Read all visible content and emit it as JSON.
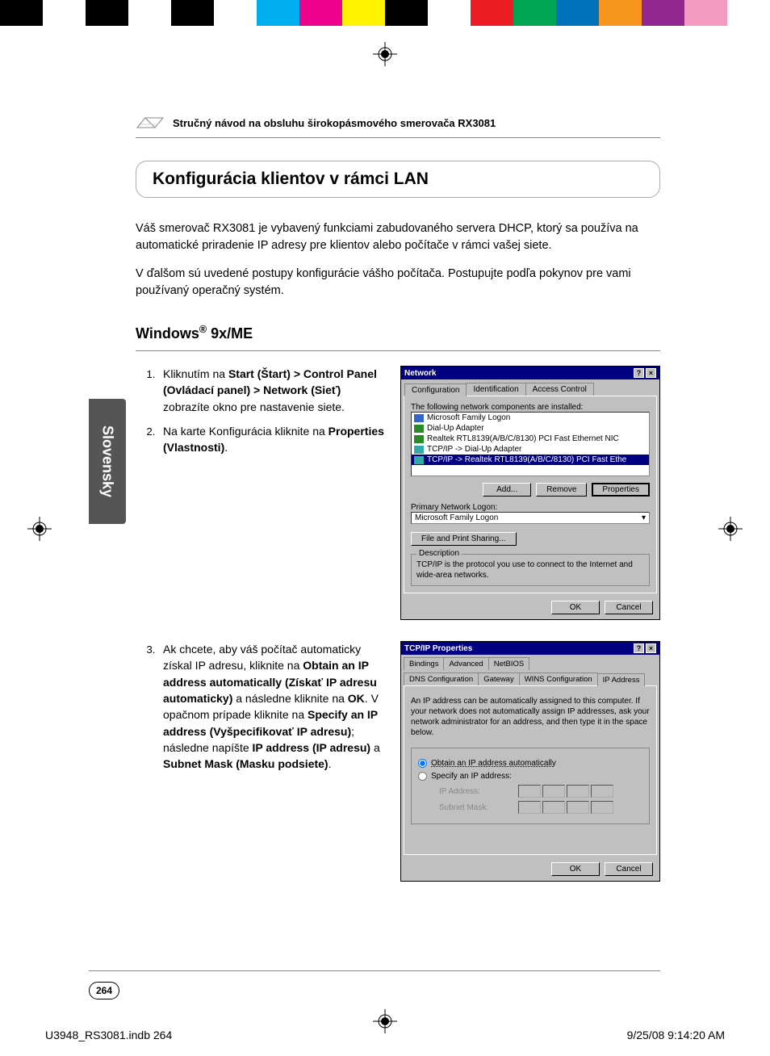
{
  "colorbar": [
    "#000000",
    "#ffffff",
    "#000000",
    "#ffffff",
    "#000000",
    "#ffffff",
    "#00aeef",
    "#ec008c",
    "#fff200",
    "#000000",
    "#ffffff",
    "#ed1c24",
    "#00a651",
    "#0072bc",
    "#f7941d",
    "#92278f",
    "#f49ac1",
    "#ffffff"
  ],
  "header": "Stručný návod na obsluhu širokopásmového smerovača RX3081",
  "sidetab": "Slovensky",
  "title": "Konfigurácia klientov v rámci LAN",
  "intro1": "Váš smerovač RX3081 je vybavený funkciami zabudovaného servera DHCP, ktorý sa používa na automatické priradenie IP adresy pre klientov alebo počítače v rámci vašej siete.",
  "intro2": "V ďalšom sú uvedené postupy konfigurácie vášho počítača. Postupujte podľa pokynov pre vami používaný operačný systém.",
  "subhead_prefix": "Windows",
  "subhead_suffix": " 9x/ME",
  "step1_a": "Kliknutím na ",
  "step1_b": "Start (Štart) > Control Panel (Ovládací panel) > Network (Sieť)",
  "step1_c": " zobrazíte okno pre nastavenie siete.",
  "step2_a": "Na karte Konfigurácia kliknite na ",
  "step2_b": "Properties (Vlastnosti)",
  "step2_c": ".",
  "step3_a": "Ak chcete, aby váš počítač automaticky získal IP adresu, kliknite na ",
  "step3_b": "Obtain an IP address automatically (Získať IP adresu automaticky)",
  "step3_c": " a následne kliknite na ",
  "step3_d": "OK",
  "step3_e": ". V opačnom prípade kliknite na ",
  "step3_f": "Specify an IP address (Vyšpecifikovať IP adresu)",
  "step3_g": "; následne napíšte ",
  "step3_h": "IP address (IP adresu)",
  "step3_i": " a ",
  "step3_j": "Subnet Mask (Masku podsiete)",
  "step3_k": ".",
  "win1": {
    "title": "Network",
    "tabs": [
      "Configuration",
      "Identification",
      "Access Control"
    ],
    "label_components": "The following network components are installed:",
    "items": [
      "Microsoft Family Logon",
      "Dial-Up Adapter",
      "Realtek RTL8139(A/B/C/8130) PCI Fast Ethernet NIC",
      "TCP/IP -> Dial-Up Adapter",
      "TCP/IP -> Realtek RTL8139(A/B/C/8130) PCI Fast Ethe"
    ],
    "btn_add": "Add...",
    "btn_remove": "Remove",
    "btn_properties": "Properties",
    "label_logon": "Primary Network Logon:",
    "logon_value": "Microsoft Family Logon",
    "btn_share": "File and Print Sharing...",
    "gb_title": "Description",
    "desc": "TCP/IP is the protocol you use to connect to the Internet and wide-area networks.",
    "ok": "OK",
    "cancel": "Cancel"
  },
  "win2": {
    "title": "TCP/IP Properties",
    "tabs_row1": [
      "Bindings",
      "Advanced",
      "NetBIOS"
    ],
    "tabs_row2": [
      "DNS Configuration",
      "Gateway",
      "WINS Configuration",
      "IP Address"
    ],
    "note": "An IP address can be automatically assigned to this computer. If your network does not automatically assign IP addresses, ask your network administrator for an address, and then type it in the space below.",
    "radio1": "Obtain an IP address automatically",
    "radio2": "Specify an IP address:",
    "lbl_ip": "IP Address:",
    "lbl_mask": "Subnet Mask:",
    "ok": "OK",
    "cancel": "Cancel"
  },
  "pagenum": "264",
  "footer_left": "U3948_RS3081.indb   264",
  "footer_right": "9/25/08   9:14:20 AM"
}
